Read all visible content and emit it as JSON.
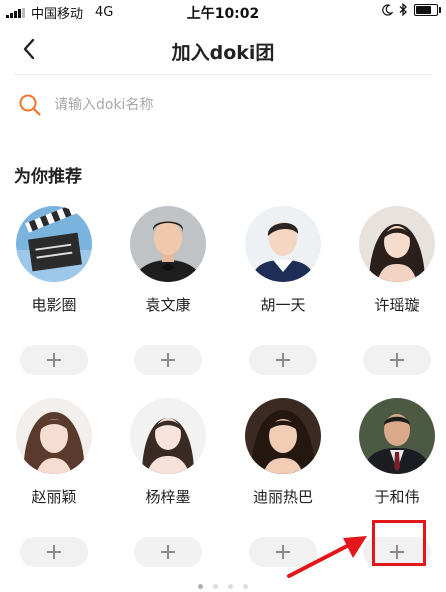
{
  "status_bar": {
    "carrier": "中国移动",
    "network": "4G",
    "time": "上午10:02",
    "battery_level": 0.85
  },
  "nav": {
    "title": "加入doki团",
    "back_icon": "chevron-left-icon"
  },
  "search": {
    "placeholder": "请输入doki名称",
    "value": "",
    "icon": "search-icon",
    "accent_color": "#f0742a"
  },
  "section": {
    "title": "为你推荐"
  },
  "recommendations": [
    {
      "name": "电影圈",
      "avatar": "clapperboard-avatar"
    },
    {
      "name": "袁文康",
      "avatar": "portrait-avatar"
    },
    {
      "name": "胡一天",
      "avatar": "portrait-avatar"
    },
    {
      "name": "许瑶璇",
      "avatar": "portrait-avatar"
    },
    {
      "name": "赵丽颖",
      "avatar": "portrait-avatar"
    },
    {
      "name": "杨梓墨",
      "avatar": "portrait-avatar"
    },
    {
      "name": "迪丽热巴",
      "avatar": "portrait-avatar"
    },
    {
      "name": "于和伟",
      "avatar": "portrait-avatar"
    }
  ],
  "join_button": {
    "icon": "plus-icon"
  },
  "annotation": {
    "color": "#e3161c",
    "target": "于和伟 join button"
  },
  "pager": {
    "pages": 4,
    "current": 1
  }
}
